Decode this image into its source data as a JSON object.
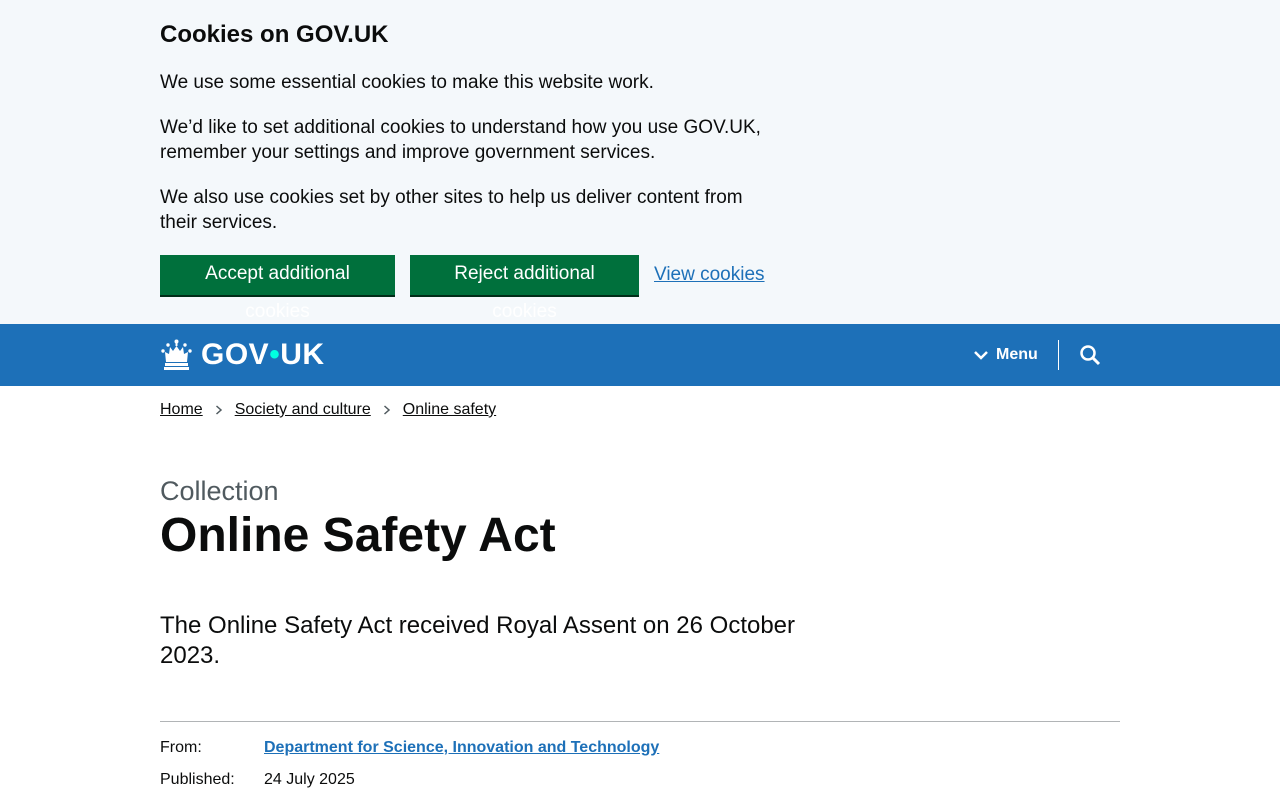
{
  "cookie_banner": {
    "title": "Cookies on GOV.UK",
    "paragraph_1": "We use some essential cookies to make this website work.",
    "paragraph_2": "We’d like to set additional cookies to understand how you use GOV.UK, remember your settings and improve government services.",
    "paragraph_3": "We also use cookies set by other sites to help us deliver content from their services.",
    "accept_label": "Accept additional cookies",
    "reject_label": "Reject additional cookies",
    "view_label": "View cookies",
    "background": "#f4f8fb",
    "button_color": "#00703c"
  },
  "header": {
    "logo_gov": "GOV",
    "logo_dot": "•",
    "logo_uk": "UK",
    "menu_label": "Menu",
    "background": "#1d70b8",
    "icons": [
      "crown-icon",
      "chevron-down-icon",
      "search-icon"
    ]
  },
  "breadcrumb": {
    "items": [
      "Home",
      "Society and culture",
      "Online safety"
    ]
  },
  "main": {
    "caption": "Collection",
    "title": "Online Safety Act",
    "lead": "The Online Safety Act received Royal Assent on 26 October 2023."
  },
  "metadata": {
    "from_label": "From:",
    "from_value": "Department for Science, Innovation and Technology",
    "published_label": "Published:",
    "published_value": "24 July 2025"
  },
  "colors": {
    "link": "#1d70b8",
    "text": "#0b0c0c",
    "secondary_text": "#505a5f"
  }
}
